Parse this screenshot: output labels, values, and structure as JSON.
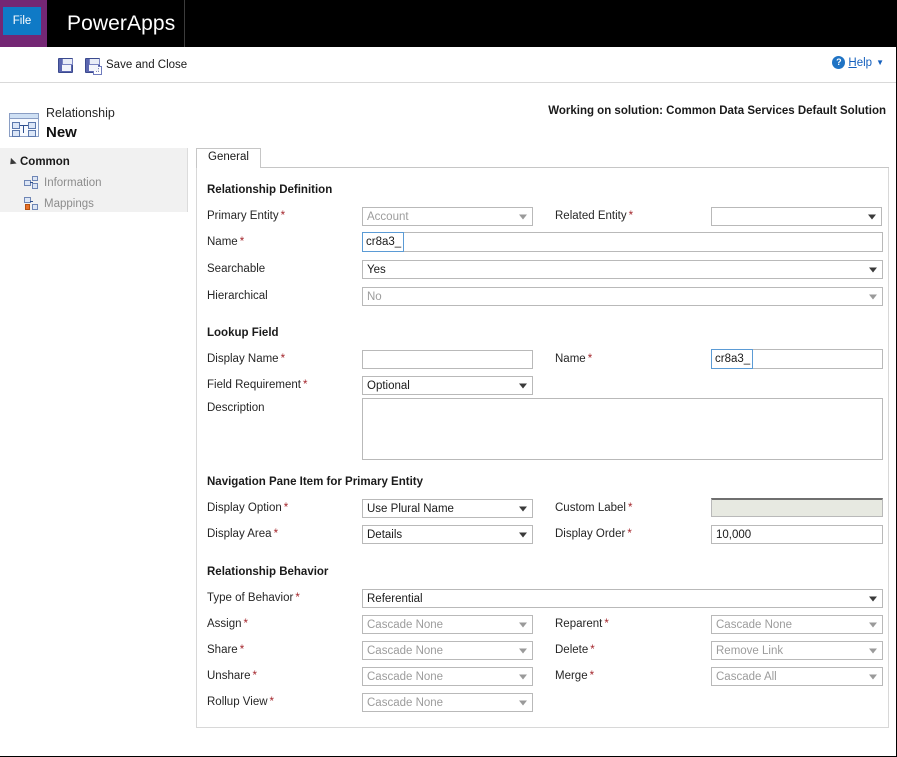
{
  "suite": {
    "waffle_icon": "app-launcher-waffle-icon",
    "title": "PowerApps"
  },
  "command_bar": {
    "file_label": "File",
    "save_label": "",
    "save_icon": "save-floppy-icon",
    "save_and_close_label": "Save and Close",
    "save_and_close_icon": "save-and-close-floppy-icon",
    "help_label": "Help",
    "help_accesskey_prefix": "H",
    "help_accesskey_rest": "elp",
    "help_icon": "help-question-circle-icon",
    "help_caret": "▼"
  },
  "title_strip": {
    "record_icon": "relationship-entity-icon",
    "kicker": "Relationship",
    "title": "New",
    "solution_note": "Working on solution: Common Data Services Default Solution"
  },
  "sidebar": {
    "group_label": "Common",
    "items": [
      {
        "label": "Information",
        "icon": "information-entity-icon"
      },
      {
        "label": "Mappings",
        "icon": "mappings-icon"
      }
    ]
  },
  "tabs": [
    {
      "label": "General",
      "active": true
    }
  ],
  "form": {
    "sections": [
      {
        "heading": "Relationship Definition",
        "fields": [
          {
            "label": "Primary Entity",
            "required": true,
            "type": "select",
            "value": "Account",
            "disabled": true
          },
          {
            "label": "Related Entity",
            "required": true,
            "type": "select",
            "value": "",
            "disabled": false
          },
          {
            "label": "Name",
            "required": true,
            "type": "prefixed-text",
            "prefix": "cr8a3_",
            "value": "",
            "disabled": false
          },
          {
            "label": "Searchable",
            "required": false,
            "type": "select",
            "value": "Yes",
            "disabled": false
          },
          {
            "label": "Hierarchical",
            "required": false,
            "type": "select",
            "value": "No",
            "disabled": true
          }
        ]
      },
      {
        "heading": "Lookup Field",
        "fields": [
          {
            "label": "Display Name",
            "required": true,
            "type": "text",
            "value": "",
            "disabled": false
          },
          {
            "label": "Name",
            "required": true,
            "type": "prefixed-text",
            "prefix": "cr8a3_",
            "value": "",
            "disabled": false
          },
          {
            "label": "Field Requirement",
            "required": true,
            "type": "select",
            "value": "Optional",
            "disabled": false
          },
          {
            "label": "Description",
            "required": false,
            "type": "textarea",
            "value": "",
            "disabled": false
          }
        ]
      },
      {
        "heading": "Navigation Pane Item for Primary Entity",
        "fields": [
          {
            "label": "Display Option",
            "required": true,
            "type": "select",
            "value": "Use Plural Name",
            "disabled": false
          },
          {
            "label": "Custom Label",
            "required": true,
            "type": "text",
            "value": "",
            "disabled": true
          },
          {
            "label": "Display Area",
            "required": true,
            "type": "select",
            "value": "Details",
            "disabled": false
          },
          {
            "label": "Display Order",
            "required": true,
            "type": "text",
            "value": "10,000",
            "disabled": false
          }
        ]
      },
      {
        "heading": "Relationship Behavior",
        "fields": [
          {
            "label": "Type of Behavior",
            "required": true,
            "type": "select",
            "value": "Referential",
            "disabled": false
          },
          {
            "label": "Assign",
            "required": true,
            "type": "select",
            "value": "Cascade None",
            "disabled": true
          },
          {
            "label": "Reparent",
            "required": true,
            "type": "select",
            "value": "Cascade None",
            "disabled": true
          },
          {
            "label": "Share",
            "required": true,
            "type": "select",
            "value": "Cascade None",
            "disabled": true
          },
          {
            "label": "Delete",
            "required": true,
            "type": "select",
            "value": "Remove Link",
            "disabled": true
          },
          {
            "label": "Unshare",
            "required": true,
            "type": "select",
            "value": "Cascade None",
            "disabled": true
          },
          {
            "label": "Merge",
            "required": true,
            "type": "select",
            "value": "Cascade All",
            "disabled": true
          },
          {
            "label": "Rollup View",
            "required": true,
            "type": "select",
            "value": "Cascade None",
            "disabled": true
          }
        ]
      }
    ]
  },
  "colors": {
    "suite_bar": "#000000",
    "waffle": "#742774",
    "file_tab": "#0f7ac6",
    "required_asterisk": "#a4262c",
    "link": "#1560bd",
    "sidebar_bg": "#f1f1f1",
    "disabled_field": "#e7e9e1"
  }
}
